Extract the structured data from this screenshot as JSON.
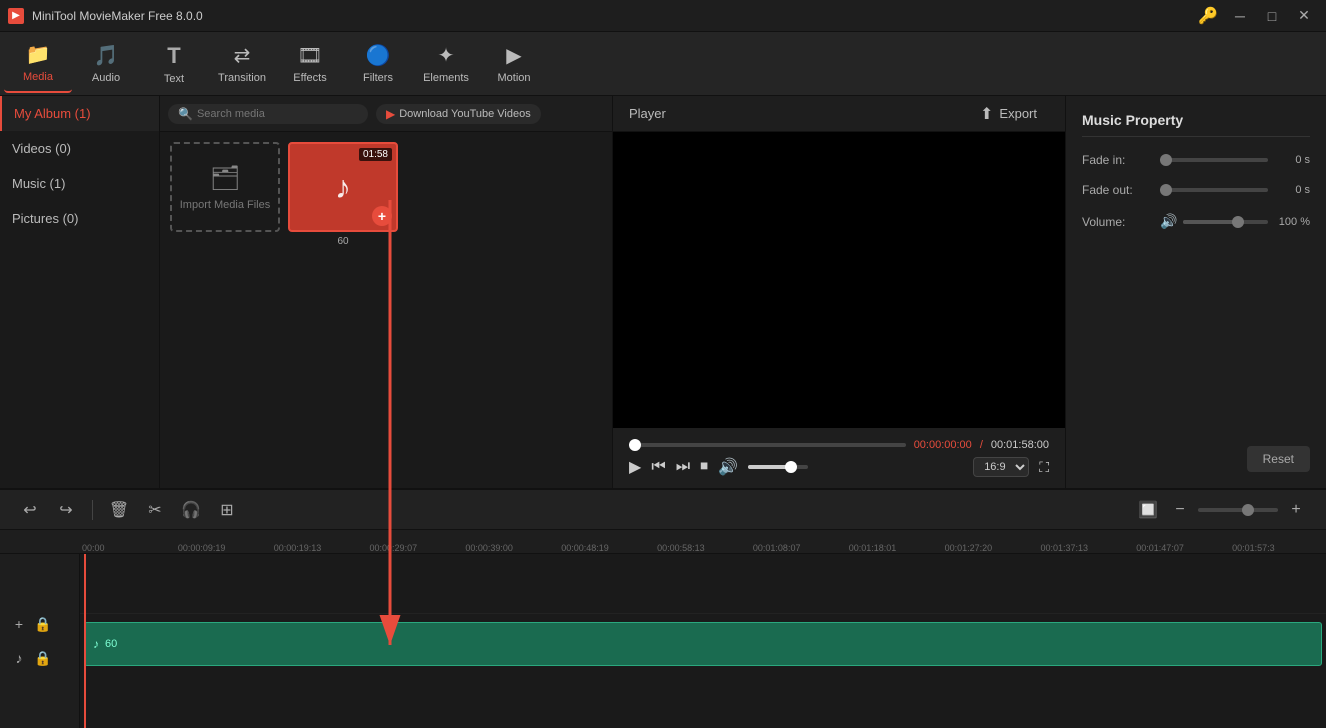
{
  "app": {
    "title": "MiniTool MovieMaker Free 8.0.0",
    "icon": "🎬"
  },
  "titlebar": {
    "key_icon": "🔑",
    "minimize": "–",
    "restore": "□",
    "close": "✕"
  },
  "toolbar": {
    "items": [
      {
        "id": "media",
        "label": "Media",
        "icon": "📁",
        "active": true
      },
      {
        "id": "audio",
        "label": "Audio",
        "icon": "🎵"
      },
      {
        "id": "text",
        "label": "Text",
        "icon": "T"
      },
      {
        "id": "transition",
        "label": "Transition",
        "icon": "⇄"
      },
      {
        "id": "effects",
        "label": "Effects",
        "icon": "🎞"
      },
      {
        "id": "filters",
        "label": "Filters",
        "icon": "🔵"
      },
      {
        "id": "elements",
        "label": "Elements",
        "icon": "✦"
      },
      {
        "id": "motion",
        "label": "Motion",
        "icon": "▶"
      }
    ]
  },
  "left_nav": {
    "items": [
      {
        "id": "my-album",
        "label": "My Album (1)",
        "active": true
      },
      {
        "id": "videos",
        "label": "Videos (0)"
      },
      {
        "id": "music",
        "label": "Music (1)"
      },
      {
        "id": "pictures",
        "label": "Pictures (0)"
      }
    ]
  },
  "media": {
    "search_placeholder": "Search media",
    "yt_btn": "Download YouTube Videos",
    "import_label": "Import Media Files",
    "thumb": {
      "duration": "01:58",
      "label": "60"
    }
  },
  "player": {
    "title": "Player",
    "export_label": "Export",
    "time_current": "00:00:00:00",
    "time_separator": " / ",
    "time_total": "00:01:58:00",
    "aspect_ratio": "16:9"
  },
  "music_property": {
    "title": "Music Property",
    "fade_in_label": "Fade in:",
    "fade_in_value": "0 s",
    "fade_out_label": "Fade out:",
    "fade_out_value": "0 s",
    "volume_label": "Volume:",
    "volume_value": "100 %",
    "reset_label": "Reset"
  },
  "timeline": {
    "toolbar_btns": [
      "↩",
      "↪",
      "🗑",
      "✂",
      "🎧",
      "✂"
    ],
    "zoom_minus": "−",
    "zoom_plus": "+",
    "ruler_marks": [
      "00:00",
      "00:00:09:19",
      "00:00:19:13",
      "00:00:29:07",
      "00:00:39:00",
      "00:00:48:19",
      "00:00:58:13",
      "00:01:08:07",
      "00:01:18:01",
      "00:01:27:20",
      "00:01:37:13",
      "00:01:47:07",
      "00:01:57:3"
    ],
    "audio_clip": {
      "icon": "♪",
      "label": "60"
    }
  }
}
